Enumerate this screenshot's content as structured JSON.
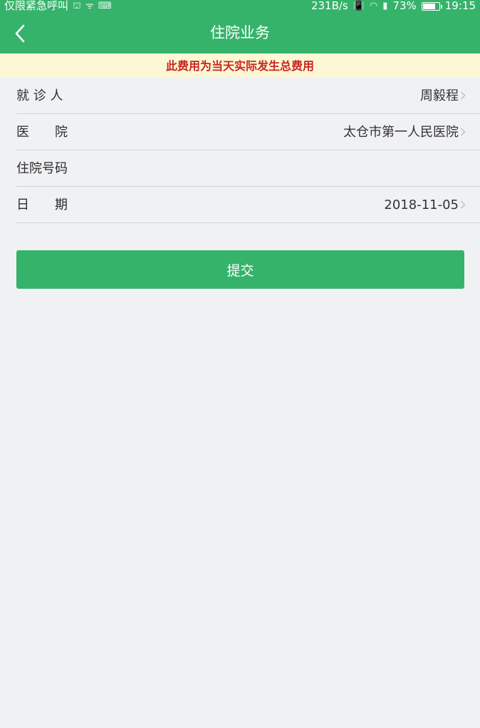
{
  "status_bar": {
    "left_text": "仅限紧急呼叫",
    "network_speed": "231B/s",
    "battery": "73%",
    "time": "19:15"
  },
  "header": {
    "title": "住院业务"
  },
  "notice": "此费用为当天实际发生总费用",
  "form": {
    "patient": {
      "label": "就 诊 人",
      "value": "周毅程"
    },
    "hospital": {
      "label": "医　　院",
      "value": "太仓市第一人民医院"
    },
    "admission_no": {
      "label": "住院号码",
      "value": ""
    },
    "date": {
      "label": "日　　期",
      "value": "2018-11-05"
    }
  },
  "submit_label": "提交",
  "colors": {
    "accent": "#36b36b",
    "notice_bg": "#fdf7d6",
    "notice_text": "#c8281f",
    "page_bg": "#f0f1f3"
  }
}
